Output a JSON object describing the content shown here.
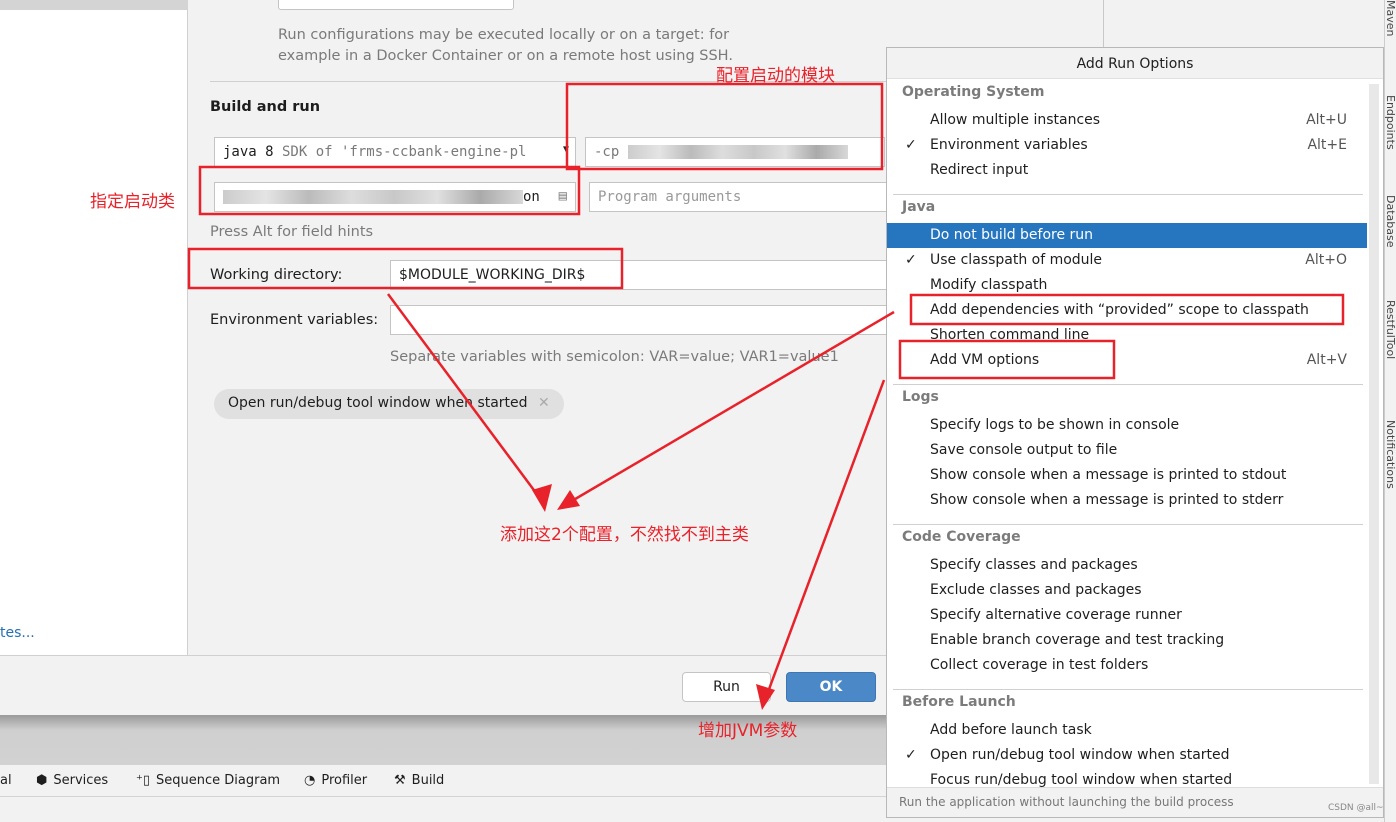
{
  "dialog": {
    "run_on_note_line1": "Run configurations may be executed locally or on a target: for",
    "run_on_note_line2": "example in a Docker Container or on a remote host using SSH.",
    "section_title": "Build and run",
    "sdk_value_bold": "java 8",
    "sdk_value_rest": " SDK of 'frms-ccbank-engine-pl",
    "cp_prefix": "-cp",
    "main_class_suffix": "on",
    "program_args_placeholder": "Program arguments",
    "field_hints": "Press Alt for field hints",
    "working_dir_label": "Working directory:",
    "working_dir_value": "$MODULE_WORKING_DIR$",
    "env_label": "Environment variables:",
    "env_hint": "Separate variables with semicolon: VAR=value; VAR1=value1",
    "chip_label": "Open run/debug tool window when started",
    "run_button": "Run",
    "ok_button": "OK"
  },
  "left_panel": {
    "link": "tes..."
  },
  "toolbar": {
    "items": [
      "al",
      "Services",
      "Sequence Diagram",
      "Profiler",
      "Build"
    ]
  },
  "right_strip": [
    "Maven",
    "Endpoints",
    "Database",
    "RestfulTool",
    "Notifications"
  ],
  "popup": {
    "title": "Add Run Options",
    "sections": [
      {
        "title": "Operating System",
        "items": [
          {
            "label": "Allow multiple instances",
            "shortcut": "Alt+U",
            "checked": false
          },
          {
            "label": "Environment variables",
            "shortcut": "Alt+E",
            "checked": true
          },
          {
            "label": "Redirect input",
            "shortcut": "",
            "checked": false
          }
        ]
      },
      {
        "title": "Java",
        "items": [
          {
            "label": "Do not build before run",
            "shortcut": "",
            "checked": false,
            "selected": true
          },
          {
            "label": "Use classpath of module",
            "shortcut": "Alt+O",
            "checked": true
          },
          {
            "label": "Modify classpath",
            "shortcut": "",
            "checked": false
          },
          {
            "label": "Add dependencies with “provided” scope to classpath",
            "shortcut": "",
            "checked": false
          },
          {
            "label": "Shorten command line",
            "shortcut": "",
            "checked": false
          },
          {
            "label": "Add VM options",
            "shortcut": "Alt+V",
            "checked": false
          }
        ]
      },
      {
        "title": "Logs",
        "items": [
          {
            "label": "Specify logs to be shown in console",
            "shortcut": "",
            "checked": false
          },
          {
            "label": "Save console output to file",
            "shortcut": "",
            "checked": false
          },
          {
            "label": "Show console when a message is printed to stdout",
            "shortcut": "",
            "checked": false
          },
          {
            "label": "Show console when a message is printed to stderr",
            "shortcut": "",
            "checked": false
          }
        ]
      },
      {
        "title": "Code Coverage",
        "items": [
          {
            "label": "Specify classes and packages",
            "shortcut": "",
            "checked": false
          },
          {
            "label": "Exclude classes and packages",
            "shortcut": "",
            "checked": false
          },
          {
            "label": "Specify alternative coverage runner",
            "shortcut": "",
            "checked": false
          },
          {
            "label": "Enable branch coverage and test tracking",
            "shortcut": "",
            "checked": false
          },
          {
            "label": "Collect coverage in test folders",
            "shortcut": "",
            "checked": false
          }
        ]
      },
      {
        "title": "Before Launch",
        "items": [
          {
            "label": "Add before launch task",
            "shortcut": "",
            "checked": false
          },
          {
            "label": "Open run/debug tool window when started",
            "shortcut": "",
            "checked": true
          },
          {
            "label": "Focus run/debug tool window when started",
            "shortcut": "",
            "checked": false
          }
        ]
      }
    ],
    "footer": "Run the application without launching the build process"
  },
  "annotations": {
    "module": "配置启动的模块",
    "main_class": "指定启动类",
    "add_two": "添加这2个配置，不然找不到主类",
    "jvm": "增加JVM参数",
    "accent": "#e8222a"
  },
  "watermark": "CSDN @all~"
}
